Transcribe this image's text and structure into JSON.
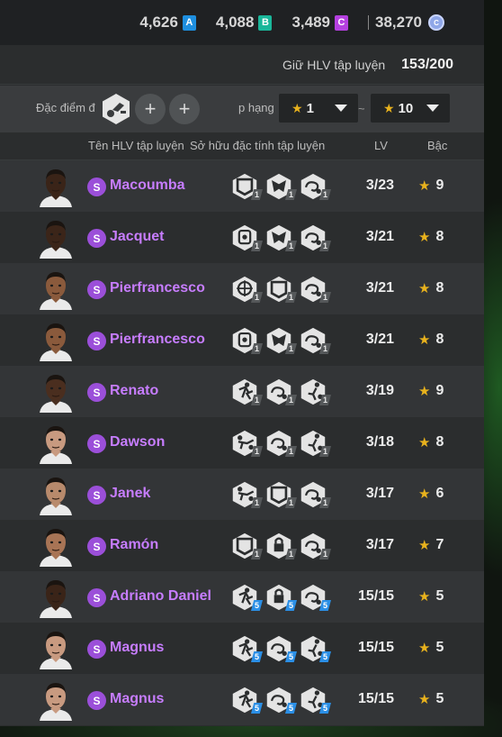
{
  "currency": [
    {
      "value": "4,626",
      "badge": "A",
      "color": "#1e8fe0"
    },
    {
      "value": "4,088",
      "badge": "B",
      "color": "#1ab79a"
    },
    {
      "value": "3,489",
      "badge": "C",
      "color": "#b540e0"
    },
    {
      "value": "38,270",
      "icon": "fc-coin-icon"
    }
  ],
  "capacity": {
    "label": "Giữ HLV tập luyện",
    "value": "153/200"
  },
  "filters": {
    "trait_label": "Đặc điểm đ",
    "rank_label": "p hạng",
    "rank_min": "1",
    "rank_max": "10",
    "separator": "~"
  },
  "columns": {
    "name": "Tên HLV tập luyện",
    "traits": "Sở hữu đặc tính tập luyện",
    "lv": "LV",
    "grade": "Bậc"
  },
  "coaches": [
    {
      "name": "Macoumba",
      "tier": "S",
      "lv": "3/23",
      "grade": "9",
      "skin": "#3a2418",
      "traits": [
        {
          "icon": "shield-icon",
          "level": "1"
        },
        {
          "icon": "mask-icon",
          "level": "1"
        },
        {
          "icon": "swirl-icon",
          "level": "1"
        }
      ]
    },
    {
      "name": "Jacquet",
      "tier": "S",
      "lv": "3/21",
      "grade": "8",
      "skin": "#3b2519",
      "traits": [
        {
          "icon": "glove-icon",
          "level": "1"
        },
        {
          "icon": "mask-icon",
          "level": "1"
        },
        {
          "icon": "swirl-icon",
          "level": "1"
        }
      ]
    },
    {
      "name": "Pierfrancesco",
      "tier": "S",
      "lv": "3/21",
      "grade": "8",
      "skin": "#8a5a3c",
      "traits": [
        {
          "icon": "target-icon",
          "level": "1"
        },
        {
          "icon": "shield-icon",
          "level": "1"
        },
        {
          "icon": "swirl-icon",
          "level": "1"
        }
      ]
    },
    {
      "name": "Pierfrancesco",
      "tier": "S",
      "lv": "3/21",
      "grade": "8",
      "skin": "#8a5a3c",
      "traits": [
        {
          "icon": "glove-icon",
          "level": "1"
        },
        {
          "icon": "mask-icon",
          "level": "1"
        },
        {
          "icon": "swirl-icon",
          "level": "1"
        }
      ]
    },
    {
      "name": "Renato",
      "tier": "S",
      "lv": "3/19",
      "grade": "9",
      "skin": "#4a2e1f",
      "traits": [
        {
          "icon": "runner-icon",
          "level": "1"
        },
        {
          "icon": "swirl-icon",
          "level": "1"
        },
        {
          "icon": "kick-icon",
          "level": "1"
        }
      ]
    },
    {
      "name": "Dawson",
      "tier": "S",
      "lv": "3/18",
      "grade": "8",
      "skin": "#c89a80",
      "traits": [
        {
          "icon": "slide-icon",
          "level": "1"
        },
        {
          "icon": "swirl-icon",
          "level": "1"
        },
        {
          "icon": "kick-icon",
          "level": "1"
        }
      ]
    },
    {
      "name": "Janek",
      "tier": "S",
      "lv": "3/17",
      "grade": "6",
      "skin": "#b88a6c",
      "traits": [
        {
          "icon": "slide-icon",
          "level": "1"
        },
        {
          "icon": "shield-icon",
          "level": "1"
        },
        {
          "icon": "swirl-icon",
          "level": "1"
        }
      ]
    },
    {
      "name": "Ramón",
      "tier": "S",
      "lv": "3/17",
      "grade": "7",
      "skin": "#a87455",
      "traits": [
        {
          "icon": "shield-icon",
          "level": "1"
        },
        {
          "icon": "lock-icon",
          "level": "1"
        },
        {
          "icon": "swirl-icon",
          "level": "1"
        }
      ]
    },
    {
      "name": "Adriano Daniel",
      "tier": "S",
      "lv": "15/15",
      "grade": "5",
      "skin": "#3a2418",
      "traits": [
        {
          "icon": "runner-icon",
          "level": "5"
        },
        {
          "icon": "lock-icon",
          "level": "5"
        },
        {
          "icon": "swirl-icon",
          "level": "5"
        }
      ]
    },
    {
      "name": "Magnus",
      "tier": "S",
      "lv": "15/15",
      "grade": "5",
      "skin": "#c89a80",
      "traits": [
        {
          "icon": "runner-icon",
          "level": "5"
        },
        {
          "icon": "swirl-icon",
          "level": "5"
        },
        {
          "icon": "kick-icon",
          "level": "5"
        }
      ]
    },
    {
      "name": "Magnus",
      "tier": "S",
      "lv": "15/15",
      "grade": "5",
      "skin": "#c89a80",
      "traits": [
        {
          "icon": "runner-icon",
          "level": "5"
        },
        {
          "icon": "swirl-icon",
          "level": "5"
        },
        {
          "icon": "kick-icon",
          "level": "5"
        }
      ]
    }
  ],
  "colors": {
    "name": "#c77dff",
    "tier_badge": "#9b4fd9",
    "star": "#e8b21d",
    "max_level": "#2b8fe6"
  }
}
